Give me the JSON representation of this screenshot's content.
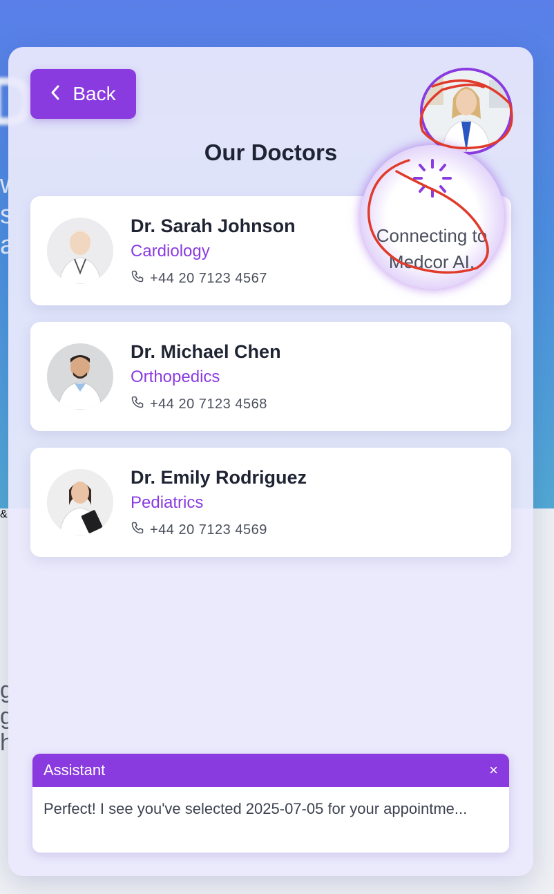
{
  "panel": {
    "back_label": "Back",
    "title": "Our Doctors"
  },
  "doctors": [
    {
      "name": "Dr. Sarah Johnson",
      "specialty": "Cardiology",
      "phone": "+44 20 7123 4567"
    },
    {
      "name": "Dr. Michael Chen",
      "specialty": "Orthopedics",
      "phone": "+44 20 7123 4568"
    },
    {
      "name": "Dr. Emily Rodriguez",
      "specialty": "Pediatrics",
      "phone": "+44 20 7123 4569"
    }
  ],
  "connecting": {
    "line1": "Connecting to",
    "line2": "Medcor AI."
  },
  "assistant": {
    "title": "Assistant",
    "close": "×",
    "message": "Perfect! I see you've selected 2025-07-05 for your appointme..."
  },
  "colors": {
    "accent": "#8a3be0",
    "annotation": "#e03a2a",
    "hero_gradient_top": "#5a7fe8",
    "hero_gradient_bottom": "#52a9d4"
  },
  "icons": {
    "back": "chevron-left-icon",
    "phone": "phone-icon",
    "spinner": "spinner-icon",
    "close": "close-icon"
  }
}
